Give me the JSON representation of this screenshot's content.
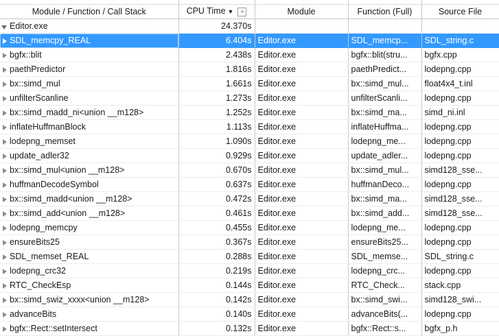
{
  "columns": {
    "name": "Module / Function / Call Stack",
    "cpu": "CPU Time",
    "sort_indicator": "▼",
    "column_button": "»",
    "module": "Module",
    "function": "Function (Full)",
    "source": "Source File"
  },
  "root": {
    "name": "Editor.exe",
    "cpu": "24.370s"
  },
  "rows": [
    {
      "name": "SDL_memcpy_REAL",
      "cpu": "6.404s",
      "module": "Editor.exe",
      "function": "SDL_memcp...",
      "source": "SDL_string.c",
      "selected": true
    },
    {
      "name": "bgfx::blit",
      "cpu": "2.438s",
      "module": "Editor.exe",
      "function": "bgfx::blit(stru...",
      "source": "bgfx.cpp"
    },
    {
      "name": "paethPredictor",
      "cpu": "1.816s",
      "module": "Editor.exe",
      "function": "paethPredict...",
      "source": "lodepng.cpp"
    },
    {
      "name": "bx::simd_mul",
      "cpu": "1.661s",
      "module": "Editor.exe",
      "function": "bx::simd_mul...",
      "source": "float4x4_t.inl"
    },
    {
      "name": "unfilterScanline",
      "cpu": "1.273s",
      "module": "Editor.exe",
      "function": "unfilterScanli...",
      "source": "lodepng.cpp"
    },
    {
      "name": "bx::simd_madd_ni<union __m128>",
      "cpu": "1.252s",
      "module": "Editor.exe",
      "function": "bx::simd_ma...",
      "source": "simd_ni.inl"
    },
    {
      "name": "inflateHuffmanBlock",
      "cpu": "1.113s",
      "module": "Editor.exe",
      "function": "inflateHuffma...",
      "source": "lodepng.cpp"
    },
    {
      "name": "lodepng_memset",
      "cpu": "1.090s",
      "module": "Editor.exe",
      "function": "lodepng_me...",
      "source": "lodepng.cpp"
    },
    {
      "name": "update_adler32",
      "cpu": "0.929s",
      "module": "Editor.exe",
      "function": "update_adler...",
      "source": "lodepng.cpp"
    },
    {
      "name": "bx::simd_mul<union __m128>",
      "cpu": "0.670s",
      "module": "Editor.exe",
      "function": "bx::simd_mul...",
      "source": "simd128_sse..."
    },
    {
      "name": "huffmanDecodeSymbol",
      "cpu": "0.637s",
      "module": "Editor.exe",
      "function": "huffmanDeco...",
      "source": "lodepng.cpp"
    },
    {
      "name": "bx::simd_madd<union __m128>",
      "cpu": "0.472s",
      "module": "Editor.exe",
      "function": "bx::simd_ma...",
      "source": "simd128_sse..."
    },
    {
      "name": "bx::simd_add<union __m128>",
      "cpu": "0.461s",
      "module": "Editor.exe",
      "function": "bx::simd_add...",
      "source": "simd128_sse..."
    },
    {
      "name": "lodepng_memcpy",
      "cpu": "0.455s",
      "module": "Editor.exe",
      "function": "lodepng_me...",
      "source": "lodepng.cpp"
    },
    {
      "name": "ensureBits25",
      "cpu": "0.367s",
      "module": "Editor.exe",
      "function": "ensureBits25...",
      "source": "lodepng.cpp"
    },
    {
      "name": "SDL_memset_REAL",
      "cpu": "0.288s",
      "module": "Editor.exe",
      "function": "SDL_memse...",
      "source": "SDL_string.c"
    },
    {
      "name": "lodepng_crc32",
      "cpu": "0.219s",
      "module": "Editor.exe",
      "function": "lodepng_crc...",
      "source": "lodepng.cpp"
    },
    {
      "name": "RTC_CheckEsp",
      "cpu": "0.144s",
      "module": "Editor.exe",
      "function": "RTC_Check...",
      "source": "stack.cpp"
    },
    {
      "name": "bx::simd_swiz_xxxx<union __m128>",
      "cpu": "0.142s",
      "module": "Editor.exe",
      "function": "bx::simd_swi...",
      "source": "simd128_swi..."
    },
    {
      "name": "advanceBits",
      "cpu": "0.140s",
      "module": "Editor.exe",
      "function": "advanceBits(...",
      "source": "lodepng.cpp"
    },
    {
      "name": "bgfx::Rect::setIntersect",
      "cpu": "0.132s",
      "module": "Editor.exe",
      "function": "bgfx::Rect::s...",
      "source": "bgfx_p.h"
    }
  ],
  "colors": {
    "selection": "#3399ff",
    "grid": "#c8c8c8"
  }
}
